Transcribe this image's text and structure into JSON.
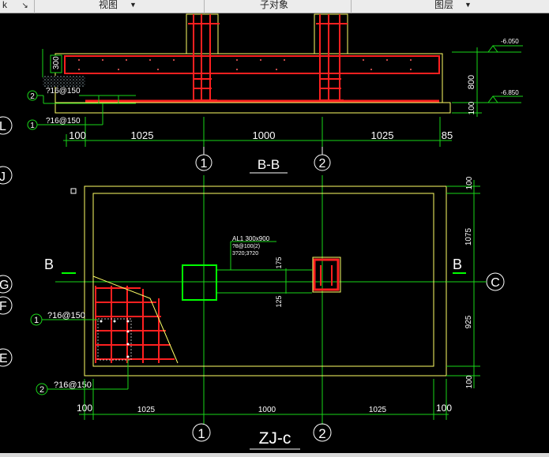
{
  "toolbar": {
    "left_labels": [
      "k",
      "↘"
    ],
    "view_label": "视图",
    "subobject_label": "子对象",
    "layer_label": "图层",
    "dropdown_arrow": "▼"
  },
  "axes": {
    "left": [
      "L",
      "J",
      "G",
      "F",
      "E"
    ],
    "columns": [
      "1",
      "2"
    ],
    "right": "C"
  },
  "section": {
    "title": "B-B",
    "levels": [
      "-6.050",
      "-6.850"
    ],
    "depths": [
      "800",
      "100"
    ],
    "cover": "300",
    "dims": [
      "100",
      "1025",
      "1000",
      "1025",
      "85"
    ],
    "bars": [
      {
        "num": "2",
        "label": "?16@150"
      },
      {
        "num": "1",
        "label": "?16@150"
      }
    ]
  },
  "plan": {
    "title": "ZJ-c",
    "cut_label": "B",
    "beam_note": [
      "AL1 300x900",
      "?8@100(2)",
      "3?20;3?20"
    ],
    "dims_bottom": [
      "100",
      "1025",
      "1000",
      "1025",
      "100"
    ],
    "dims_right": [
      "100",
      "1075",
      "925",
      "100"
    ],
    "dims_inner": [
      "175",
      "125"
    ],
    "bars": [
      {
        "num": "1",
        "label": "?16@150"
      },
      {
        "num": "2",
        "label": "?16@150"
      }
    ]
  },
  "colors": {
    "background": "#000000",
    "rebar": "#ff2020",
    "outline": "#ffff66",
    "dimension": "#19d619",
    "axis": "#ffffff",
    "column": "#00ff00"
  }
}
